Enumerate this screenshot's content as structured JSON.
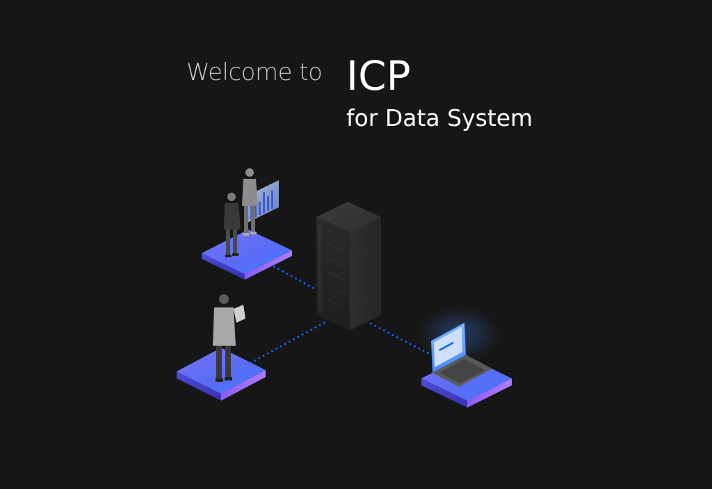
{
  "hero": {
    "welcome_text": "Welcome to",
    "product_name": "ICP",
    "product_subtitle": "for Data System"
  },
  "colors": {
    "background": "#161616",
    "connection_dots": "#0f62fe",
    "platform_top": "#6e6bf6",
    "platform_glow": "#4589ff",
    "server": "#262626"
  },
  "illustration": {
    "elements": [
      "server-rack",
      "data-analysts-with-chart",
      "person-with-tablet",
      "laptop-workstation"
    ]
  }
}
